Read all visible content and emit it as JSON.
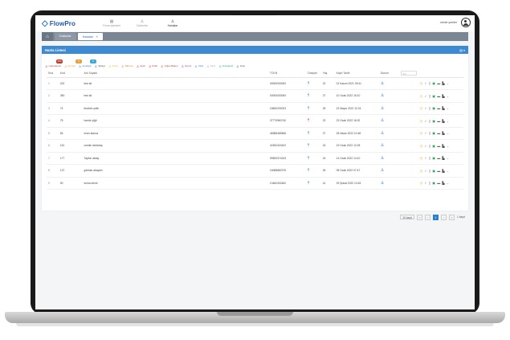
{
  "app": {
    "logo_text": "FlowPro"
  },
  "nav": [
    {
      "label": "Firma işlemleri",
      "icon": "building-icon",
      "active": false
    },
    {
      "label": "Doktorlar",
      "icon": "user-icon",
      "active": false
    },
    {
      "label": "Hastalar",
      "icon": "user-icon",
      "active": true
    }
  ],
  "user": {
    "name": "nerde yeniler"
  },
  "tabs": [
    {
      "label": "Doktorlar",
      "active": false
    },
    {
      "label": "Hastalar",
      "active": true
    }
  ],
  "panel": {
    "title": "Hasta Listesi"
  },
  "legend": [
    {
      "label": "Laboratuvar",
      "color": "#c0392b",
      "badge": "999",
      "badge_color": "#c0392b"
    },
    {
      "label": "Kontrol",
      "color": "#e6a23c",
      "badge": "0",
      "badge_color": "#e6a23c"
    },
    {
      "label": "Ameliyat",
      "color": "#2a7fd0",
      "badge": "0",
      "badge_color": "#3aaad8"
    },
    {
      "label": "Tahliye",
      "color": "#555555"
    },
    {
      "label": "Planlı",
      "color": "#e6c23c"
    },
    {
      "label": "Taburcu",
      "color": "#e67e22"
    },
    {
      "label": "Sevk",
      "color": "#c0392b"
    },
    {
      "label": "Kritik",
      "color": "#c0392b"
    },
    {
      "label": "Yoğun Bakım",
      "color": "#c0392b"
    },
    {
      "label": "Servis",
      "color": "#8e44ad"
    },
    {
      "label": "Yatış",
      "color": "#2a7fd0"
    },
    {
      "label": "Kayıt",
      "color": "#aaaaaa"
    },
    {
      "label": "Onaylandı",
      "color": "#27ae60"
    },
    {
      "label": "Arşiv",
      "color": "#555555"
    }
  ],
  "table": {
    "headers": [
      "Sıra",
      "Kod",
      "Adı Soyadı",
      "TCKN",
      "Cinsiyet",
      "Yaş",
      "Kayıt Tarihi",
      "Durum",
      ""
    ],
    "filter_placeholder": "Ara",
    "rows": [
      {
        "sira": "1",
        "kod": "202",
        "ad": "test ali",
        "tc": "00000000000",
        "gender": "M",
        "yas": "22",
        "tarih": "01 Kasım 2021 09:41"
      },
      {
        "sira": "2",
        "kod": "350",
        "ad": "test ali",
        "tc": "00000000000",
        "gender": "M",
        "yas": "27",
        "tarih": "10 Ocak 2022 15:10"
      },
      {
        "sira": "3",
        "kod": "74",
        "ad": "ibrahim çelik",
        "tc": "18840230023",
        "gender": "M",
        "yas": "25",
        "tarih": "22 Mayıs 2022 12:24"
      },
      {
        "sira": "4",
        "kod": "75",
        "ad": "hande yiğit",
        "tc": "37770960740",
        "gender": "F",
        "yas": "23",
        "tarih": "23 Ocak 2022 16:32"
      },
      {
        "sira": "5",
        "kod": "83",
        "ad": "ersin alanoz",
        "tc": "46988489608",
        "gender": "M",
        "yas": "27",
        "tarih": "28 Nisan 2022 10:48"
      },
      {
        "sira": "6",
        "kod": "151",
        "ad": "cemile demirtaş",
        "tc": "42452420422",
        "gender": "M",
        "yas": "24",
        "tarih": "19 Ocak 2022 12:28"
      },
      {
        "sira": "7",
        "kod": "177",
        "ad": "Tayfun aktaş",
        "tc": "99500374243",
        "gender": "M",
        "yas": "24",
        "tarih": "14 Ocak 2022 14:10"
      },
      {
        "sira": "8",
        "kod": "137",
        "ad": "gökhan akaydin",
        "tc": "16088882375",
        "gender": "M",
        "yas": "26",
        "tarih": "08 Ocak 2022 07:47"
      },
      {
        "sira": "9",
        "kod": "90",
        "ad": "sema demir",
        "tc": "10462402462",
        "gender": "M",
        "yas": "41",
        "tarih": "29 Şubat 2022 10:45"
      }
    ]
  },
  "pager": {
    "per_page": "10 kayıt",
    "current": "1",
    "total_label": "1 kayıt",
    "prev": "‹",
    "next": "›",
    "first": "«",
    "last": "»"
  }
}
